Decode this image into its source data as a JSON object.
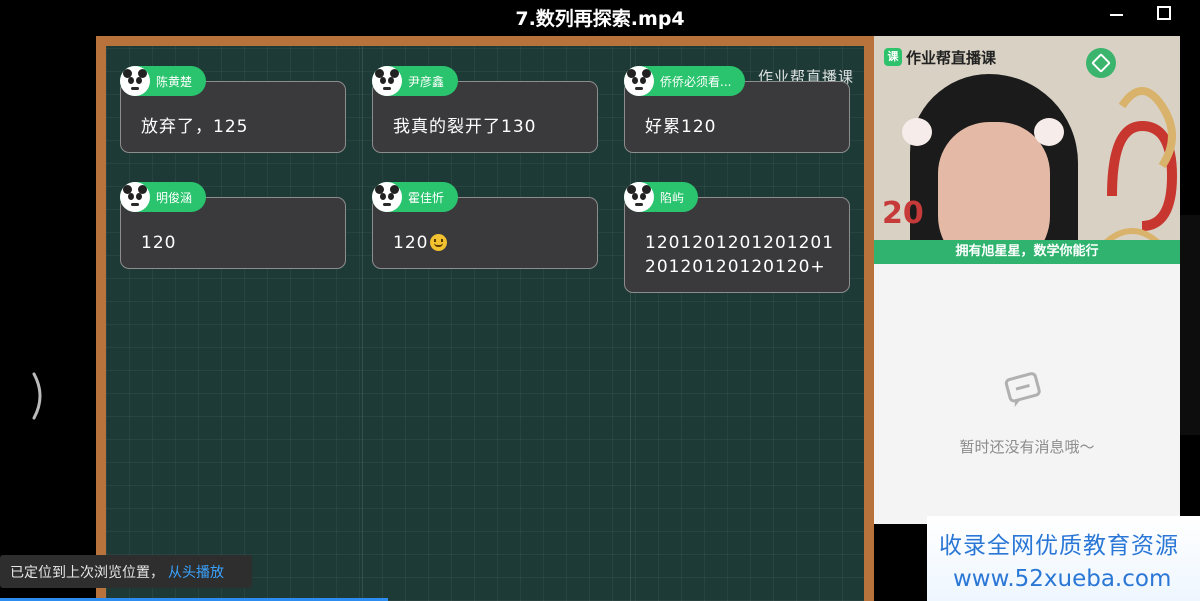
{
  "window": {
    "title": "7.数列再探索.mp4"
  },
  "board": {
    "watermark": "作业帮直播课"
  },
  "messages": [
    {
      "name": "陈黄楚",
      "text": "放弃了，125"
    },
    {
      "name": "尹彦鑫",
      "text": "我真的裂开了130"
    },
    {
      "name": "侨侨必须看...",
      "text": "好累120"
    },
    {
      "name": "明俊涵",
      "text": "120"
    },
    {
      "name": "霍佳忻",
      "text": "120",
      "emoji": "smiley-icon"
    },
    {
      "name": "陷屿",
      "line1": "1201201201201201",
      "line2": "20120120120120+"
    }
  ],
  "video": {
    "brand": "作业帮直播课",
    "banner": "拥有旭星星，数学你能行",
    "year_fragment": "20"
  },
  "chat": {
    "empty_text": "暂时还没有消息哦～"
  },
  "promo": {
    "line1": "收录全网优质教育资源",
    "line2": "www.52xueba.com"
  },
  "toast": {
    "message": "已定位到上次浏览位置，",
    "link": "从头播放"
  },
  "colors": {
    "tag_green": "#29c46d",
    "board": "#1e3a36",
    "frame": "#b8733d",
    "link_blue": "#3aa3ff"
  }
}
